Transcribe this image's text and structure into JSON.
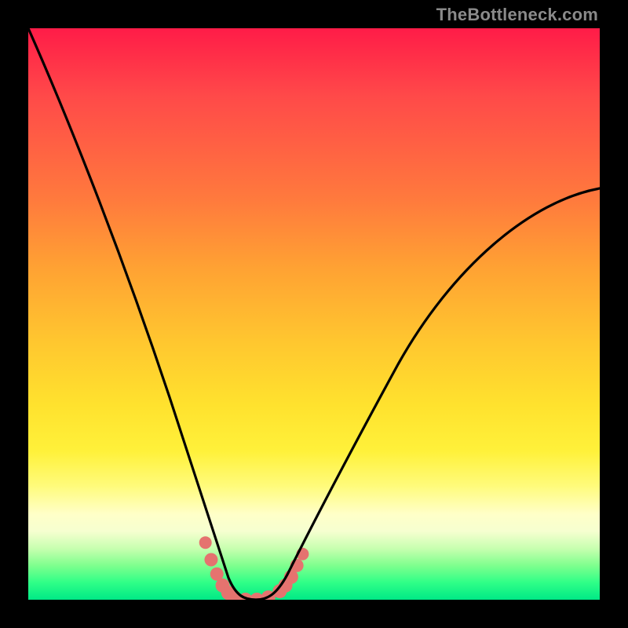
{
  "watermark": {
    "text": "TheBottleneck.com"
  },
  "chart_data": {
    "type": "line",
    "title": "",
    "xlabel": "",
    "ylabel": "",
    "xlim": [
      0,
      100
    ],
    "ylim": [
      0,
      100
    ],
    "grid": false,
    "background": "rainbow-gradient-vertical",
    "series": [
      {
        "name": "bottleneck-curve",
        "color": "#000000",
        "x": [
          0,
          4,
          8,
          12,
          16,
          20,
          24,
          28,
          30,
          32,
          34,
          36,
          38,
          40,
          42,
          44,
          48,
          54,
          60,
          66,
          72,
          78,
          84,
          90,
          96,
          100
        ],
        "y": [
          100,
          90,
          79,
          68,
          58,
          48,
          38,
          28,
          23,
          18,
          12,
          6,
          2,
          0,
          0,
          2,
          5,
          11,
          18,
          26,
          34,
          42,
          50,
          58,
          66,
          72
        ]
      }
    ],
    "annotations": [
      {
        "name": "valley-band",
        "type": "scatter-band",
        "color": "#e5736f",
        "points": [
          {
            "x": 31,
            "y": 10
          },
          {
            "x": 32,
            "y": 7
          },
          {
            "x": 33,
            "y": 4.5
          },
          {
            "x": 34,
            "y": 2.5
          },
          {
            "x": 35,
            "y": 1.2
          },
          {
            "x": 36,
            "y": 0.5
          },
          {
            "x": 38,
            "y": 0
          },
          {
            "x": 40,
            "y": 0
          },
          {
            "x": 42,
            "y": 0.4
          },
          {
            "x": 44,
            "y": 1.5
          },
          {
            "x": 45,
            "y": 2.5
          },
          {
            "x": 46,
            "y": 4
          },
          {
            "x": 47,
            "y": 6
          },
          {
            "x": 48,
            "y": 8
          }
        ]
      }
    ]
  }
}
